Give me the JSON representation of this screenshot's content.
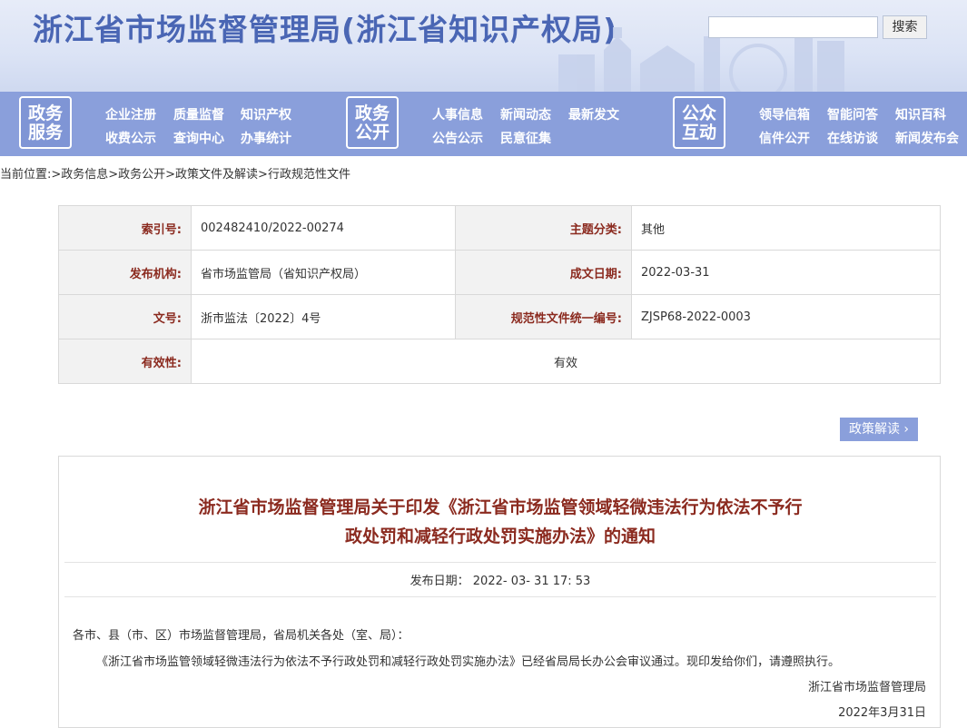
{
  "header": {
    "site_title": "浙江省市场监督管理局(浙江省知识产权局)",
    "search_placeholder": "",
    "search_button": "搜索"
  },
  "nav": {
    "badges": [
      "政务服务",
      "政务公开",
      "公众互动"
    ],
    "badge_lines": [
      [
        "政务",
        "服务"
      ],
      [
        "政务",
        "公开"
      ],
      [
        "公众",
        "互动"
      ]
    ],
    "group1": [
      "企业注册",
      "质量监督",
      "知识产权",
      "收费公示",
      "查询中心",
      "办事统计"
    ],
    "group2": [
      "人事信息",
      "新闻动态",
      "最新发文",
      "公告公示",
      "民意征集"
    ],
    "group3": [
      "领导信箱",
      "智能问答",
      "知识百科",
      "信件公开",
      "在线访谈",
      "新闻发布会"
    ]
  },
  "breadcrumb": "当前位置:>政务信息>政务公开>政策文件及解读>行政规范性文件",
  "info": {
    "index_label": "索引号:",
    "index_value": "002482410/2022-00274",
    "topic_label": "主题分类:",
    "topic_value": "其他",
    "org_label": "发布机构:",
    "org_value": "省市场监管局（省知识产权局）",
    "date_label": "成文日期:",
    "date_value": "2022-03-31",
    "docno_label": "文号:",
    "docno_value": "浙市监法〔2022〕4号",
    "code_label": "规范性文件统一编号:",
    "code_value": "ZJSP68-2022-0003",
    "valid_label": "有效性:",
    "valid_value": "有效"
  },
  "policy_button": "政策解读",
  "article": {
    "title_line1": "浙江省市场监督管理局关于印发《浙江省市场监管领域轻微违法行为依法不予行",
    "title_line2": "政处罚和减轻行政处罚实施办法》的通知",
    "pub_date": "发布日期： 2022- 03- 31 17: 53",
    "salutation": "各市、县（市、区）市场监督管理局，省局机关各处（室、局）：",
    "paragraph": "《浙江省市场监管领域轻微违法行为依法不予行政处罚和减轻行政处罚实施办法》已经省局局长办公会审议通过。现印发给你们，请遵照执行。",
    "signature": "浙江省市场监督管理局",
    "sign_date": "2022年3月31日"
  }
}
